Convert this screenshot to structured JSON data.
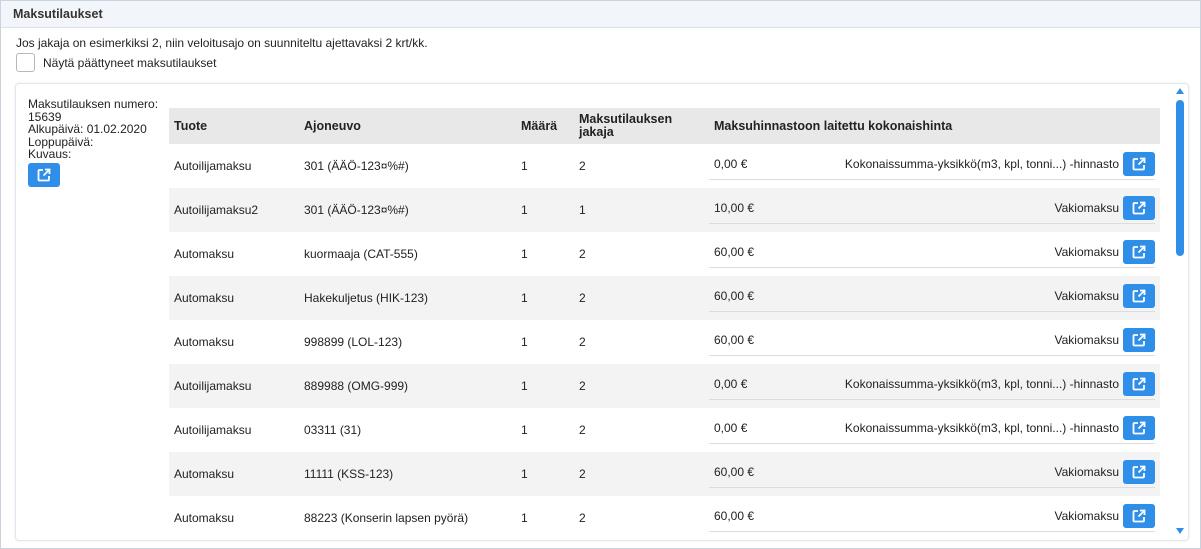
{
  "panel": {
    "title": "Maksutilaukset"
  },
  "info_text": "Jos jakaja on esimerkiksi 2, niin veloitusajo on suunniteltu ajettavaksi 2 krt/kk.",
  "show_ended_label": "Näytä päättyneet maksutilaukset",
  "order": {
    "number_label": "Maksutilauksen numero:",
    "number": "15639",
    "start_label": "Alkupäivä: 01.02.2020",
    "end_label": "Loppupäivä:",
    "desc_label": "Kuvaus:"
  },
  "table": {
    "headers": {
      "product": "Tuote",
      "vehicle": "Ajoneuvo",
      "quantity": "Määrä",
      "divider_l1": "Maksutilauksen",
      "divider_l2": "jakaja",
      "price": "Maksuhinnastoon laitettu kokonaishinta"
    },
    "rows": [
      {
        "product": "Autoilijamaksu",
        "vehicle": "301 (ÄÄÖ-123¤%#)",
        "quantity": "1",
        "divider": "2",
        "price": "0,00 €",
        "price_type": "Kokonaissumma-yksikkö(m3, kpl, tonni...) -hinnasto"
      },
      {
        "product": "Autoilijamaksu2",
        "vehicle": "301 (ÄÄÖ-123¤%#)",
        "quantity": "1",
        "divider": "1",
        "price": "10,00 €",
        "price_type": "Vakiomaksu"
      },
      {
        "product": "Automaksu",
        "vehicle": "kuormaaja (CAT-555)",
        "quantity": "1",
        "divider": "2",
        "price": "60,00 €",
        "price_type": "Vakiomaksu"
      },
      {
        "product": "Automaksu",
        "vehicle": "Hakekuljetus (HIK-123)",
        "quantity": "1",
        "divider": "2",
        "price": "60,00 €",
        "price_type": "Vakiomaksu"
      },
      {
        "product": "Automaksu",
        "vehicle": "998899 (LOL-123)",
        "quantity": "1",
        "divider": "2",
        "price": "60,00 €",
        "price_type": "Vakiomaksu"
      },
      {
        "product": "Autoilijamaksu",
        "vehicle": "889988 (OMG-999)",
        "quantity": "1",
        "divider": "2",
        "price": "0,00 €",
        "price_type": "Kokonaissumma-yksikkö(m3, kpl, tonni...) -hinnasto"
      },
      {
        "product": "Autoilijamaksu",
        "vehicle": "03311 (31)",
        "quantity": "1",
        "divider": "2",
        "price": "0,00 €",
        "price_type": "Kokonaissumma-yksikkö(m3, kpl, tonni...) -hinnasto"
      },
      {
        "product": "Automaksu",
        "vehicle": "11111 (KSS-123)",
        "quantity": "1",
        "divider": "2",
        "price": "60,00 €",
        "price_type": "Vakiomaksu"
      },
      {
        "product": "Automaksu",
        "vehicle": "88223 (Konserin lapsen pyörä)",
        "quantity": "1",
        "divider": "2",
        "price": "60,00 €",
        "price_type": "Vakiomaksu"
      }
    ]
  },
  "colors": {
    "accent": "#2f8fe8",
    "header_bg": "#e8e8e8",
    "alt_row": "#f3f3f3"
  },
  "icons": {
    "open": "external-link-icon"
  }
}
